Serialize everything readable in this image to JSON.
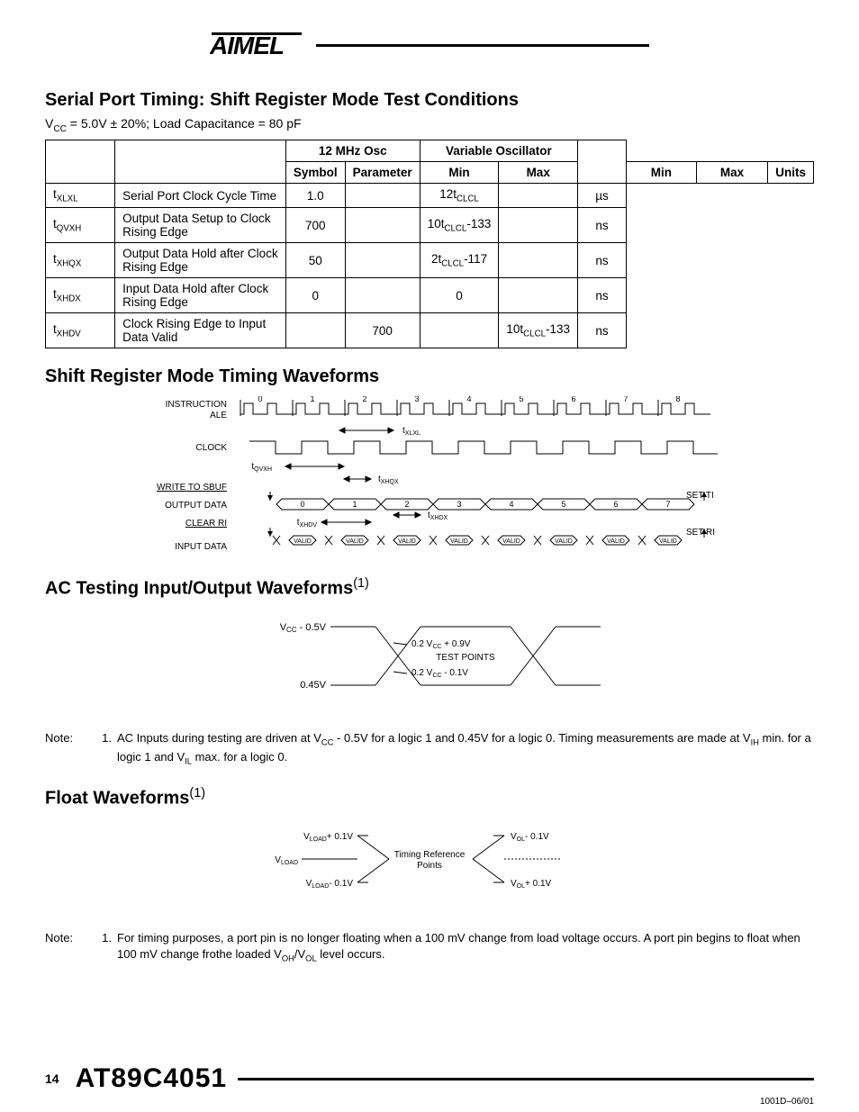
{
  "header": {
    "logo_text": "ATMEL"
  },
  "section1": {
    "title": "Serial Port Timing: Shift Register Mode Test Conditions",
    "conditions_prefix": "V",
    "conditions_sub": "CC",
    "conditions_rest": " = 5.0V ± 20%; Load Capacitance = 80 pF",
    "col_osc": "12 MHz Osc",
    "col_varosc": "Variable Oscillator",
    "col_symbol": "Symbol",
    "col_parameter": "Parameter",
    "col_min": "Min",
    "col_max": "Max",
    "col_units": "Units",
    "rows": [
      {
        "sym_pre": "t",
        "sym_sub": "XLXL",
        "param": "Serial Port Clock Cycle Time",
        "min12": "1.0",
        "max12": "",
        "minvar_pre": "12t",
        "minvar_sub": "CLCL",
        "minvar_post": "",
        "maxvar": "",
        "units": "µs"
      },
      {
        "sym_pre": "t",
        "sym_sub": "QVXH",
        "param": "Output Data Setup to Clock Rising Edge",
        "min12": "700",
        "max12": "",
        "minvar_pre": "10t",
        "minvar_sub": "CLCL",
        "minvar_post": "-133",
        "maxvar": "",
        "units": "ns"
      },
      {
        "sym_pre": "t",
        "sym_sub": "XHQX",
        "param": "Output Data Hold after Clock Rising Edge",
        "min12": "50",
        "max12": "",
        "minvar_pre": "2t",
        "minvar_sub": "CLCL",
        "minvar_post": "-117",
        "maxvar": "",
        "units": "ns"
      },
      {
        "sym_pre": "t",
        "sym_sub": "XHDX",
        "param": "Input Data Hold after Clock Rising Edge",
        "min12": "0",
        "max12": "",
        "minvar_pre": "0",
        "minvar_sub": "",
        "minvar_post": "",
        "maxvar": "",
        "units": "ns"
      },
      {
        "sym_pre": "t",
        "sym_sub": "XHDV",
        "param": "Clock Rising Edge to Input Data Valid",
        "min12": "",
        "max12": "700",
        "minvar_pre": "",
        "minvar_sub": "",
        "minvar_post": "",
        "maxvar_pre": "10t",
        "maxvar_sub": "CLCL",
        "maxvar_post": "-133",
        "units": "ns"
      }
    ]
  },
  "section2": {
    "title": "Shift Register Mode Timing Waveforms",
    "labels": {
      "instruction": "INSTRUCTION",
      "ale": "ALE",
      "clock": "CLOCK",
      "write_sbuf": "WRITE TO SBUF",
      "output_data": "OUTPUT DATA",
      "clear_ri": "CLEAR RI",
      "input_data": "INPUT DATA",
      "set_ti": "SET TI",
      "set_ri": "SET RI",
      "valid": "VALID",
      "t_xlxl": "t",
      "t_xlxl_sub": "XLXL",
      "t_qvxh": "t",
      "t_qvxh_sub": "QVXH",
      "t_xhqx": "t",
      "t_xhqx_sub": "XHQX",
      "t_xhdx": "t",
      "t_xhdx_sub": "XHDX",
      "t_xhdv": "t",
      "t_xhdv_sub": "XHDV"
    }
  },
  "section3": {
    "title_pre": "AC Testing Input/Output Waveforms",
    "title_sup": "(1)",
    "labels": {
      "vcc_minus": " - 0.5V",
      "test_points": "TEST POINTS",
      "p02_plus": " + 0.9V",
      "p02_minus": " - 0.1V",
      "v045": "0.45V",
      "vcc": "V",
      "vcc_sub": "CC",
      "p02": "0.2 V"
    },
    "note_label": "Note:",
    "note_num": "1.",
    "note_text_1": "AC Inputs during testing are driven at V",
    "note_text_2": " - 0.5V for a logic 1 and 0.45V for a logic 0. Timing measurements are made at V",
    "note_text_3": " min. for a logic 1 and V",
    "note_text_4": " max. for a logic 0.",
    "note_sub_cc": "CC",
    "note_sub_ih": "IH",
    "note_sub_il": "IL"
  },
  "section4": {
    "title_pre": "Float Waveforms",
    "title_sup": "(1)",
    "labels": {
      "vload": "V",
      "vload_sub": "LOAD",
      "vload_plus": "+ 0.1V",
      "vload_minus": "- 0.1V",
      "vol": "V",
      "vol_sub": "OL",
      "vol_plus": "+ 0.1V",
      "vol_minus": "- 0.1V",
      "timing_ref": "Timing Reference",
      "points": "Points"
    },
    "note_label": "Note:",
    "note_num": "1.",
    "note_text_1": "For timing purposes, a port pin is no longer floating when a 100 mV change from load voltage occurs. A port pin begins to float when 100 mV change frothe loaded V",
    "note_text_2": "/V",
    "note_text_3": " level occurs.",
    "note_sub_oh": "OH",
    "note_sub_ol": "OL"
  },
  "footer": {
    "page": "14",
    "part": "AT89C4051",
    "docid": "1001D–06/01"
  }
}
